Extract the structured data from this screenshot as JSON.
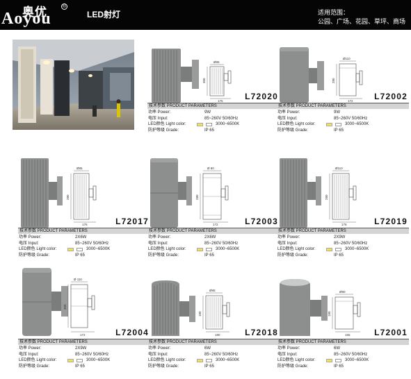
{
  "header": {
    "logo_cn": "奥优",
    "logo_en": "Aoyou",
    "registered_mark": "®",
    "title": "LED射灯",
    "application_label": "适用范围：",
    "application_text": "公园、广场、花园、草坪、商场"
  },
  "param_labels": {
    "heading": "技术参数 PRODUCT PARAMETERS",
    "power": "功率 Power:",
    "input": "电压 Input:",
    "light_color": "LED颜色 Light color:",
    "grade": "防护等级 Grade:"
  },
  "products": [
    {
      "model": "L72020",
      "power": "9W",
      "input": "85~260V 50/60Hz",
      "cct": "3000~6500K",
      "grade": "IP 65",
      "dims": {
        "dia": "Ø85",
        "height": "300",
        "depth": "175"
      }
    },
    {
      "model": "L72002",
      "power": "9W",
      "input": "85~260V 50/60Hz",
      "cct": "3000~6500K",
      "grade": "IP 65",
      "dims": {
        "dia": "Ø110",
        "height": "280",
        "depth": "172"
      }
    },
    {
      "model": "L72017",
      "power": "2X6W",
      "input": "85~260V 50/60Hz",
      "cct": "3000~6500K",
      "grade": "IP 65",
      "dims": {
        "dia": "Ø85",
        "height": "280",
        "depth": "176"
      }
    },
    {
      "model": "L72003",
      "power": "2X6W",
      "input": "85~260V 50/60Hz",
      "cct": "3000~6500K",
      "grade": "IP 65",
      "dims": {
        "dia": "Ø 80",
        "height": "280",
        "depth": "172"
      }
    },
    {
      "model": "L72019",
      "power": "2X9W",
      "input": "85~260V 50/60Hz",
      "cct": "3000~6500K",
      "grade": "IP 65",
      "dims": {
        "dia": "Ø110",
        "height": "280",
        "depth": "176"
      }
    },
    {
      "model": "L72004",
      "power": "2X9W",
      "input": "85~260V 50/60Hz",
      "cct": "3000~6500K",
      "grade": "IP 65",
      "dims": {
        "dia": "Ø 110",
        "height": "300",
        "depth": "172"
      }
    },
    {
      "model": "L72018",
      "power": "6W",
      "input": "85~260V 50/60Hz",
      "cct": "3000~6500K",
      "grade": "IP 65",
      "dims": {
        "dia": "Ø85",
        "height": "180",
        "depth": "180"
      }
    },
    {
      "model": "L72001",
      "power": "6W",
      "input": "85~260V 50/60Hz",
      "cct": "3000~6500K",
      "grade": "IP 65",
      "dims": {
        "dia": "Ø90",
        "height": "180",
        "depth": "155"
      }
    }
  ],
  "colors": {
    "header_bg": "#050505",
    "lamp_grey": "#8d8f8f",
    "param_head_bg": "#d4d4d4",
    "light_swatch": "#f2e25a"
  }
}
